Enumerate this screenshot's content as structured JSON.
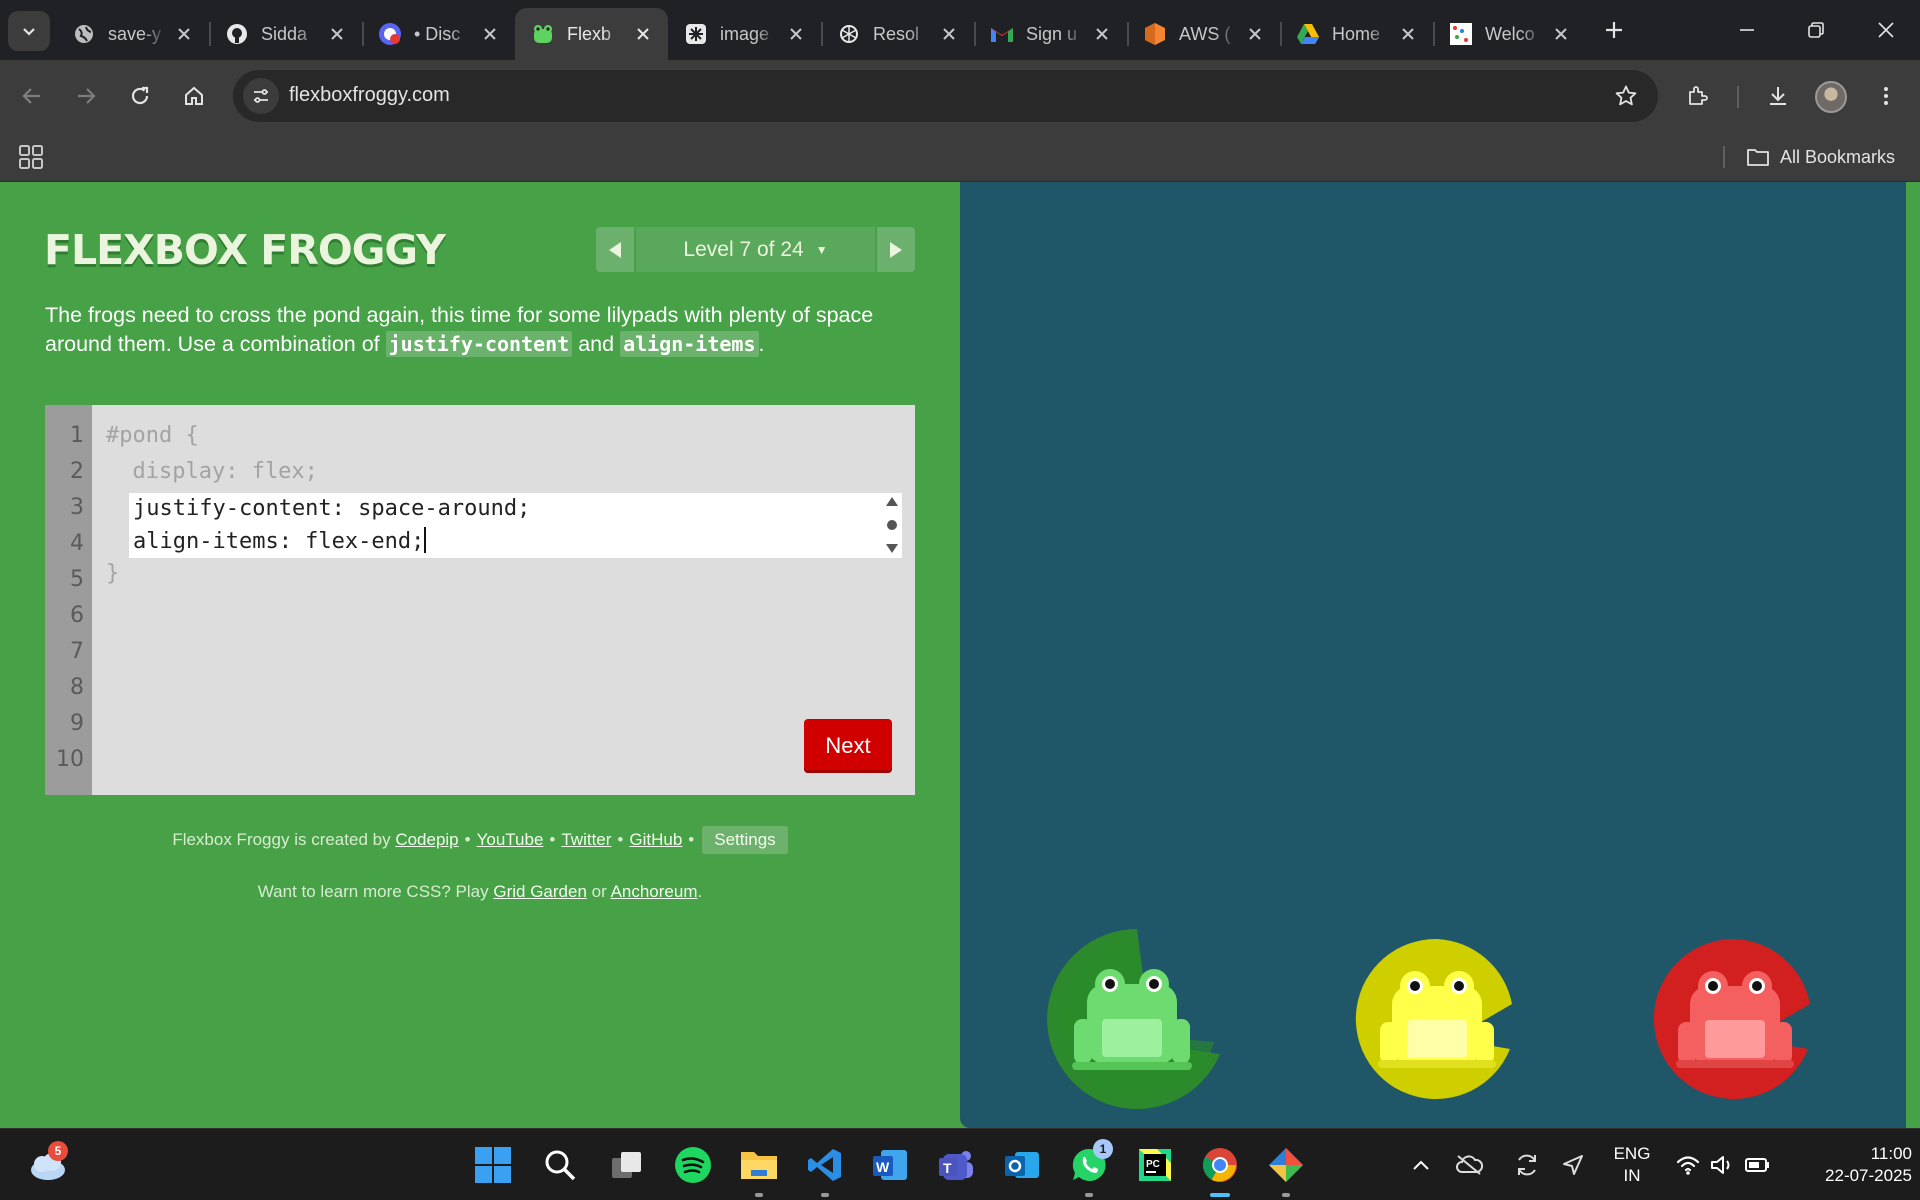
{
  "browser": {
    "tabs": [
      {
        "title": "save-y",
        "favicon": "globe-icon"
      },
      {
        "title": "Sidda",
        "favicon": "github-icon"
      },
      {
        "title": "• Disc",
        "favicon": "discord-icon"
      },
      {
        "title": "Flexb",
        "favicon": "frog-icon",
        "active": true
      },
      {
        "title": "image",
        "favicon": "openai-icon"
      },
      {
        "title": "Resol",
        "favicon": "chatgpt-icon"
      },
      {
        "title": "Sign u",
        "favicon": "gmail-icon"
      },
      {
        "title": "AWS (",
        "favicon": "aws-icon"
      },
      {
        "title": "Home",
        "favicon": "drive-icon"
      },
      {
        "title": "Welco",
        "favicon": "dots-icon"
      }
    ],
    "url": "flexboxfroggy.com",
    "all_bookmarks_label": "All Bookmarks"
  },
  "game": {
    "logo": "FLEXBOX FROGGY",
    "level_label": "Level 7 of 24",
    "instructions_before": "The frogs need to cross the pond again, this time for some lilypads with plenty of space around them. Use a combination of ",
    "code1": "justify-content",
    "instructions_mid": " and ",
    "code2": "align-items",
    "instructions_after": ".",
    "line_numbers": [
      "1",
      "2",
      "3",
      "4",
      "5",
      "6",
      "7",
      "8",
      "9",
      "10"
    ],
    "code_line1": "#pond {",
    "code_line2": "  display: flex;",
    "input_line1": "justify-content: space-around;",
    "input_line2": "align-items: flex-end;",
    "code_close": "}",
    "next_label": "Next",
    "credits_prefix": "Flexbox Froggy is created by",
    "credits_links": [
      "Codepip",
      "YouTube",
      "Twitter",
      "GitHub"
    ],
    "settings_label": "Settings",
    "learn_prefix": "Want to learn more CSS? Play",
    "learn_link1": "Grid Garden",
    "learn_or": "or",
    "learn_link2": "Anchoreum",
    "learn_end": ".",
    "frogs": [
      {
        "color": "green",
        "lilypad": "#2c8a2d",
        "body": "#6ddb6f"
      },
      {
        "color": "yellow",
        "lilypad": "#cfcf00",
        "body": "#ffff49"
      },
      {
        "color": "red",
        "lilypad": "#d21f1f",
        "body": "#f46060"
      }
    ]
  },
  "taskbar": {
    "weather_badge": "5",
    "whatsapp_badge": "1",
    "lang_line1": "ENG",
    "lang_line2": "IN",
    "time": "11:00",
    "date": "22-07-2025"
  }
}
